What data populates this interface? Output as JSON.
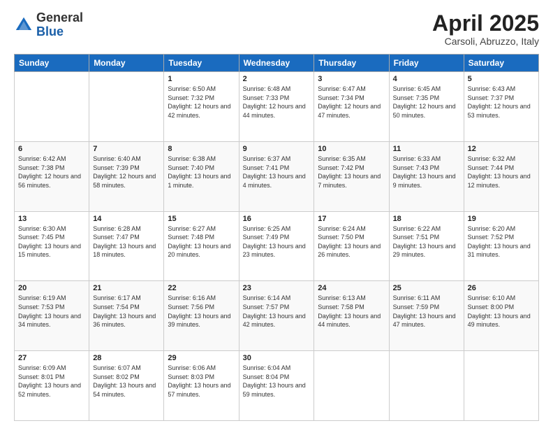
{
  "header": {
    "logo_general": "General",
    "logo_blue": "Blue",
    "month_year": "April 2025",
    "location": "Carsoli, Abruzzo, Italy"
  },
  "days_of_week": [
    "Sunday",
    "Monday",
    "Tuesday",
    "Wednesday",
    "Thursday",
    "Friday",
    "Saturday"
  ],
  "weeks": [
    [
      {
        "day": "",
        "sunrise": "",
        "sunset": "",
        "daylight": ""
      },
      {
        "day": "",
        "sunrise": "",
        "sunset": "",
        "daylight": ""
      },
      {
        "day": "1",
        "sunrise": "Sunrise: 6:50 AM",
        "sunset": "Sunset: 7:32 PM",
        "daylight": "Daylight: 12 hours and 42 minutes."
      },
      {
        "day": "2",
        "sunrise": "Sunrise: 6:48 AM",
        "sunset": "Sunset: 7:33 PM",
        "daylight": "Daylight: 12 hours and 44 minutes."
      },
      {
        "day": "3",
        "sunrise": "Sunrise: 6:47 AM",
        "sunset": "Sunset: 7:34 PM",
        "daylight": "Daylight: 12 hours and 47 minutes."
      },
      {
        "day": "4",
        "sunrise": "Sunrise: 6:45 AM",
        "sunset": "Sunset: 7:35 PM",
        "daylight": "Daylight: 12 hours and 50 minutes."
      },
      {
        "day": "5",
        "sunrise": "Sunrise: 6:43 AM",
        "sunset": "Sunset: 7:37 PM",
        "daylight": "Daylight: 12 hours and 53 minutes."
      }
    ],
    [
      {
        "day": "6",
        "sunrise": "Sunrise: 6:42 AM",
        "sunset": "Sunset: 7:38 PM",
        "daylight": "Daylight: 12 hours and 56 minutes."
      },
      {
        "day": "7",
        "sunrise": "Sunrise: 6:40 AM",
        "sunset": "Sunset: 7:39 PM",
        "daylight": "Daylight: 12 hours and 58 minutes."
      },
      {
        "day": "8",
        "sunrise": "Sunrise: 6:38 AM",
        "sunset": "Sunset: 7:40 PM",
        "daylight": "Daylight: 13 hours and 1 minute."
      },
      {
        "day": "9",
        "sunrise": "Sunrise: 6:37 AM",
        "sunset": "Sunset: 7:41 PM",
        "daylight": "Daylight: 13 hours and 4 minutes."
      },
      {
        "day": "10",
        "sunrise": "Sunrise: 6:35 AM",
        "sunset": "Sunset: 7:42 PM",
        "daylight": "Daylight: 13 hours and 7 minutes."
      },
      {
        "day": "11",
        "sunrise": "Sunrise: 6:33 AM",
        "sunset": "Sunset: 7:43 PM",
        "daylight": "Daylight: 13 hours and 9 minutes."
      },
      {
        "day": "12",
        "sunrise": "Sunrise: 6:32 AM",
        "sunset": "Sunset: 7:44 PM",
        "daylight": "Daylight: 13 hours and 12 minutes."
      }
    ],
    [
      {
        "day": "13",
        "sunrise": "Sunrise: 6:30 AM",
        "sunset": "Sunset: 7:45 PM",
        "daylight": "Daylight: 13 hours and 15 minutes."
      },
      {
        "day": "14",
        "sunrise": "Sunrise: 6:28 AM",
        "sunset": "Sunset: 7:47 PM",
        "daylight": "Daylight: 13 hours and 18 minutes."
      },
      {
        "day": "15",
        "sunrise": "Sunrise: 6:27 AM",
        "sunset": "Sunset: 7:48 PM",
        "daylight": "Daylight: 13 hours and 20 minutes."
      },
      {
        "day": "16",
        "sunrise": "Sunrise: 6:25 AM",
        "sunset": "Sunset: 7:49 PM",
        "daylight": "Daylight: 13 hours and 23 minutes."
      },
      {
        "day": "17",
        "sunrise": "Sunrise: 6:24 AM",
        "sunset": "Sunset: 7:50 PM",
        "daylight": "Daylight: 13 hours and 26 minutes."
      },
      {
        "day": "18",
        "sunrise": "Sunrise: 6:22 AM",
        "sunset": "Sunset: 7:51 PM",
        "daylight": "Daylight: 13 hours and 29 minutes."
      },
      {
        "day": "19",
        "sunrise": "Sunrise: 6:20 AM",
        "sunset": "Sunset: 7:52 PM",
        "daylight": "Daylight: 13 hours and 31 minutes."
      }
    ],
    [
      {
        "day": "20",
        "sunrise": "Sunrise: 6:19 AM",
        "sunset": "Sunset: 7:53 PM",
        "daylight": "Daylight: 13 hours and 34 minutes."
      },
      {
        "day": "21",
        "sunrise": "Sunrise: 6:17 AM",
        "sunset": "Sunset: 7:54 PM",
        "daylight": "Daylight: 13 hours and 36 minutes."
      },
      {
        "day": "22",
        "sunrise": "Sunrise: 6:16 AM",
        "sunset": "Sunset: 7:56 PM",
        "daylight": "Daylight: 13 hours and 39 minutes."
      },
      {
        "day": "23",
        "sunrise": "Sunrise: 6:14 AM",
        "sunset": "Sunset: 7:57 PM",
        "daylight": "Daylight: 13 hours and 42 minutes."
      },
      {
        "day": "24",
        "sunrise": "Sunrise: 6:13 AM",
        "sunset": "Sunset: 7:58 PM",
        "daylight": "Daylight: 13 hours and 44 minutes."
      },
      {
        "day": "25",
        "sunrise": "Sunrise: 6:11 AM",
        "sunset": "Sunset: 7:59 PM",
        "daylight": "Daylight: 13 hours and 47 minutes."
      },
      {
        "day": "26",
        "sunrise": "Sunrise: 6:10 AM",
        "sunset": "Sunset: 8:00 PM",
        "daylight": "Daylight: 13 hours and 49 minutes."
      }
    ],
    [
      {
        "day": "27",
        "sunrise": "Sunrise: 6:09 AM",
        "sunset": "Sunset: 8:01 PM",
        "daylight": "Daylight: 13 hours and 52 minutes."
      },
      {
        "day": "28",
        "sunrise": "Sunrise: 6:07 AM",
        "sunset": "Sunset: 8:02 PM",
        "daylight": "Daylight: 13 hours and 54 minutes."
      },
      {
        "day": "29",
        "sunrise": "Sunrise: 6:06 AM",
        "sunset": "Sunset: 8:03 PM",
        "daylight": "Daylight: 13 hours and 57 minutes."
      },
      {
        "day": "30",
        "sunrise": "Sunrise: 6:04 AM",
        "sunset": "Sunset: 8:04 PM",
        "daylight": "Daylight: 13 hours and 59 minutes."
      },
      {
        "day": "",
        "sunrise": "",
        "sunset": "",
        "daylight": ""
      },
      {
        "day": "",
        "sunrise": "",
        "sunset": "",
        "daylight": ""
      },
      {
        "day": "",
        "sunrise": "",
        "sunset": "",
        "daylight": ""
      }
    ]
  ]
}
